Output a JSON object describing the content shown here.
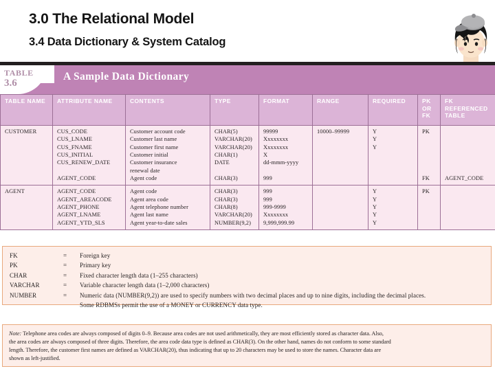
{
  "slide": {
    "title": "3.0 The Relational Model",
    "subtitle": "3.4 Data Dictionary & System Catalog"
  },
  "avatar": {
    "icon": "student-avatar-with-cap"
  },
  "table_banner": {
    "table_label": "TABLE",
    "table_number": "3.6",
    "title": "A Sample Data Dictionary"
  },
  "dictionary": {
    "headers": [
      "TABLE NAME",
      "ATTRIBUTE NAME",
      "CONTENTS",
      "TYPE",
      "FORMAT",
      "RANGE",
      "REQUIRED",
      "PK\nOR\nFK",
      "FK\nREFERENCED\nTABLE"
    ],
    "rows": [
      {
        "table_name": [
          "CUSTOMER"
        ],
        "attribute_name": [
          "CUS_CODE",
          "CUS_LNAME",
          "CUS_FNAME",
          "CUS_INITIAL",
          "CUS_RENEW_DATE",
          "",
          "AGENT_CODE"
        ],
        "contents": [
          "Customer account code",
          "Customer last name",
          "Customer first name",
          "Customer initial",
          "Customer insurance",
          "renewal date",
          "Agent code"
        ],
        "type": [
          "CHAR(5)",
          "VARCHAR(20)",
          "VARCHAR(20)",
          "CHAR(1)",
          "DATE",
          "",
          "CHAR(3)"
        ],
        "format": [
          "99999",
          "Xxxxxxxx",
          "Xxxxxxxx",
          "X",
          "dd-mmm-yyyy",
          "",
          "999"
        ],
        "range": [
          "10000–99999",
          "",
          "",
          "",
          "",
          "",
          ""
        ],
        "required": [
          "Y",
          "Y",
          "Y",
          "",
          "",
          "",
          ""
        ],
        "pk_or_fk": [
          "PK",
          "",
          "",
          "",
          "",
          "",
          "FK"
        ],
        "fk_referenced_table": [
          "",
          "",
          "",
          "",
          "",
          "",
          "AGENT_CODE"
        ]
      },
      {
        "table_name": [
          "AGENT"
        ],
        "attribute_name": [
          "AGENT_CODE",
          "AGENT_AREACODE",
          "AGENT_PHONE",
          "AGENT_LNAME",
          "AGENT_YTD_SLS"
        ],
        "contents": [
          "Agent code",
          "Agent area code",
          "Agent telephone number",
          "Agent last name",
          "Agent year-to-date sales"
        ],
        "type": [
          "CHAR(3)",
          "CHAR(3)",
          "CHAR(8)",
          "VARCHAR(20)",
          "NUMBER(9,2)"
        ],
        "format": [
          "999",
          "999",
          "999-9999",
          "Xxxxxxxx",
          "9,999,999.99"
        ],
        "range": [
          "",
          "",
          "",
          "",
          ""
        ],
        "required": [
          "Y",
          "Y",
          "Y",
          "Y",
          "Y"
        ],
        "pk_or_fk": [
          "PK",
          "",
          "",
          "",
          ""
        ],
        "fk_referenced_table": [
          "",
          "",
          "",
          "",
          ""
        ]
      }
    ]
  },
  "legend": {
    "equals_sign": "=",
    "entries": [
      {
        "term": "FK",
        "definition": "Foreign key"
      },
      {
        "term": "PK",
        "definition": "Primary key"
      },
      {
        "term": "CHAR",
        "definition": "Fixed character length data (1–255 characters)"
      },
      {
        "term": "VARCHAR",
        "definition": "Variable character length data (1–2,000 characters)"
      },
      {
        "term": "NUMBER",
        "definition": "Numeric data (NUMBER(9,2)) are used to specify numbers with two decimal places and up to nine digits, including the decimal places."
      },
      {
        "term": "",
        "definition": "Some RDBMSs permit the use of a MONEY or CURRENCY data type."
      }
    ]
  },
  "note": {
    "label": "Note:",
    "lines": [
      "Telephone area codes are always composed of digits 0–9. Because area codes are not used arithmetically, they are most efficiently stored as character data. Also,",
      "the area codes are always composed of three digits. Therefore, the area code data type is defined as CHAR(3). On the other hand, names do not conform to some standard",
      "length. Therefore, the customer first names are defined as VARCHAR(20), thus indicating that up to 20 characters may be used to store the names. Character data are",
      "shown as left-justified."
    ]
  },
  "colors": {
    "banner": "#bf83b5",
    "header_row": "#dcb4d7",
    "cell_bg": "#fae8f0",
    "cell_border": "#9c6f96",
    "note_bg": "#fdeee9",
    "note_border": "#e8a87c",
    "rule": "#231f20"
  }
}
